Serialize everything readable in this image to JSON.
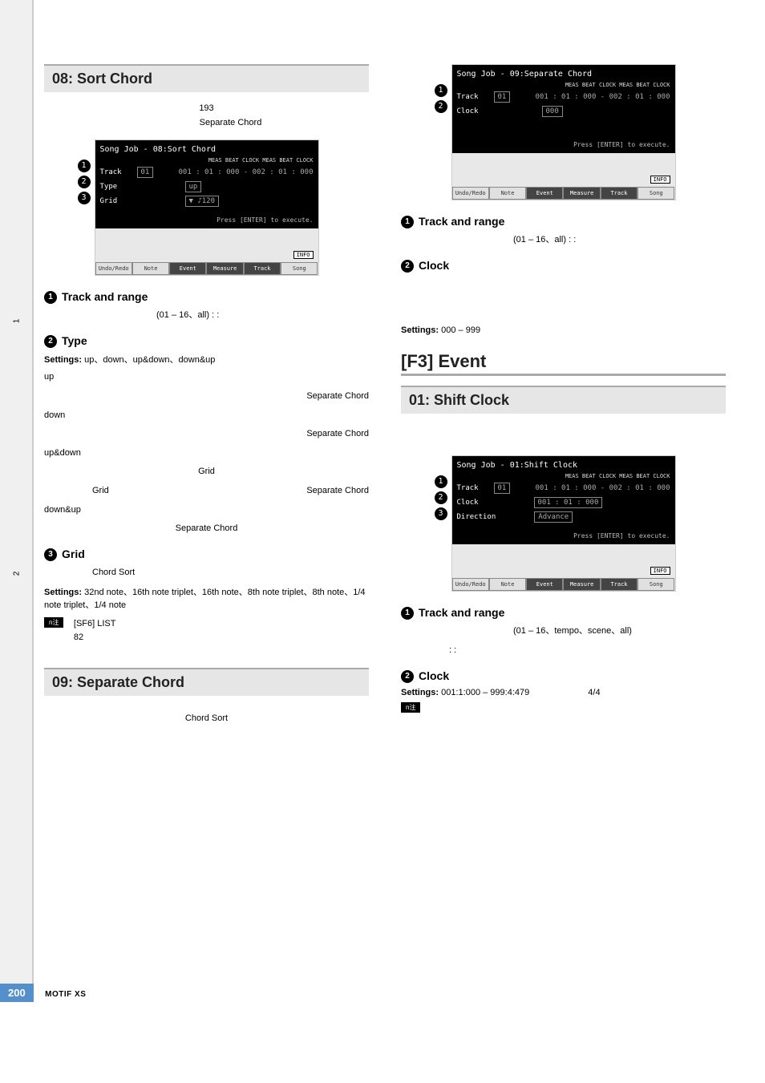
{
  "sidebar": {
    "num1": "1",
    "num2": "2"
  },
  "footer": {
    "page": "200",
    "model": "MOTIF XS"
  },
  "note_label": "n注",
  "left": {
    "sec08": {
      "title": "08: Sort Chord",
      "pre_num": "193",
      "pre_txt": "Separate Chord",
      "shot": {
        "title": "Song Job - 08:Sort Chord",
        "hdr": "MEAS  BEAT  CLOCK       MEAS  BEAT  CLOCK",
        "vals": "001 : 01 : 000  -  002 : 01 : 000",
        "track": "Track",
        "track_val": "01",
        "type": "Type",
        "type_val": "up",
        "grid": "Grid",
        "grid_val": "▼ ♪120",
        "enter": "Press [ENTER] to execute.",
        "info": "INFO",
        "tabs": [
          "Undo/Redo",
          "Note",
          "Event",
          "Measure",
          "Track",
          "Song"
        ]
      },
      "p1": {
        "head": "Track and range",
        "txt": "(01 – 16、all)                :      :"
      },
      "p2": {
        "head": "Type",
        "settings_label": "Settings:",
        "settings": "up、down、up&down、down&up",
        "up_lbl": "up",
        "up_txt": "Separate Chord",
        "down_lbl": "down",
        "down_txt": "Separate Chord",
        "ud_lbl": "up&down",
        "ud_txt1": "Grid",
        "ud_txt2": "Grid",
        "ud_txt3": "Separate Chord",
        "du_lbl": "down&up",
        "du_txt": "Separate Chord"
      },
      "p3": {
        "head": "Grid",
        "txt1": "Chord Sort",
        "settings_label": "Settings:",
        "settings": "32nd note、16th note triplet、16th note、8th note triplet、8th note、1/4 note triplet、1/4 note",
        "note1": "[SF6] LIST",
        "note2": "82"
      }
    },
    "sec09": {
      "title": "09: Separate Chord",
      "txt": "Chord Sort"
    }
  },
  "right": {
    "shot09": {
      "title": "Song Job - 09:Separate Chord",
      "hdr": "MEAS  BEAT  CLOCK       MEAS  BEAT  CLOCK",
      "vals": "001 : 01 : 000  -  002 : 01 : 000",
      "track": "Track",
      "track_val": "01",
      "clock": "Clock",
      "clock_val": "000",
      "enter": "Press [ENTER] to execute.",
      "info": "INFO",
      "tabs": [
        "Undo/Redo",
        "Note",
        "Event",
        "Measure",
        "Track",
        "Song"
      ]
    },
    "p1": {
      "head": "Track and range",
      "txt": "(01 – 16、all)                :      :"
    },
    "p2": {
      "head": "Clock",
      "settings_label": "Settings:",
      "settings": "000 – 999"
    },
    "f3": {
      "title": "[F3] Event",
      "sec01": "01: Shift Clock"
    },
    "shot01": {
      "title": "Song Job - 01:Shift Clock",
      "hdr": "MEAS  BEAT  CLOCK       MEAS  BEAT  CLOCK",
      "vals": "001 : 01 : 000  -  002 : 01 : 000",
      "track": "Track",
      "track_val": "01",
      "clock": "Clock",
      "clock_val": "001 : 01 : 000",
      "dir": "Direction",
      "dir_val": "Advance",
      "enter": "Press [ENTER] to execute.",
      "info": "INFO",
      "tabs": [
        "Undo/Redo",
        "Note",
        "Event",
        "Measure",
        "Track",
        "Song"
      ]
    },
    "p3": {
      "head": "Track and range",
      "txt": "(01 – 16、tempo、scene、all)",
      "txt2": "        :       :"
    },
    "p4": {
      "head": "Clock",
      "settings_label": "Settings:",
      "settings": "001:1:000 – 999:4:479",
      "extra": "4/4"
    }
  }
}
